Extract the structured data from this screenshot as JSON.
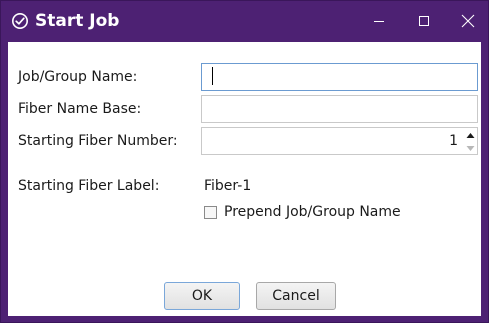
{
  "window": {
    "title": "Start Job",
    "title_icon": "check-circle-icon",
    "controls": [
      "minimize-icon",
      "maximize-icon",
      "close-icon"
    ],
    "accent_color": "#4d2173"
  },
  "form": {
    "job_group_name": {
      "label": "Job/Group Name:",
      "value": ""
    },
    "fiber_name_base": {
      "label": "Fiber Name Base:",
      "value": ""
    },
    "starting_fiber_number": {
      "label": "Starting Fiber Number:",
      "value": "1"
    },
    "starting_fiber_label": {
      "label": "Starting Fiber Label:",
      "value": "Fiber-1"
    },
    "prepend_checkbox": {
      "label": "Prepend Job/Group Name",
      "checked": false
    }
  },
  "buttons": {
    "ok_label": "OK",
    "cancel_label": "Cancel"
  }
}
